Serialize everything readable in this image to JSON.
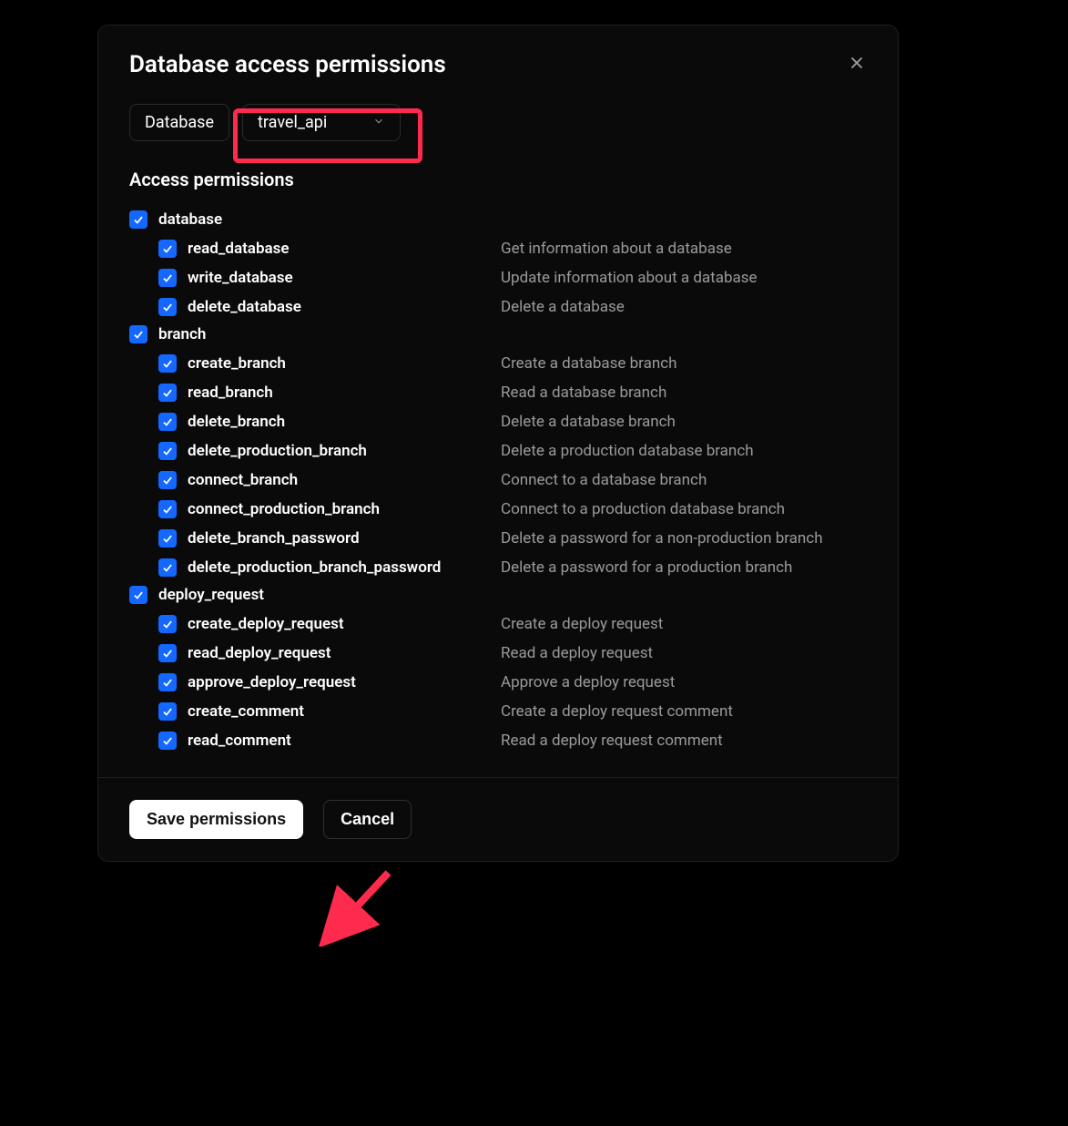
{
  "modal": {
    "title": "Database access permissions",
    "database_label": "Database",
    "database_selected": "travel_api",
    "section_title": "Access permissions",
    "save_label": "Save permissions",
    "cancel_label": "Cancel"
  },
  "groups": [
    {
      "name": "database",
      "checked": true,
      "perms": [
        {
          "name": "read_database",
          "desc": "Get information about a database",
          "checked": true
        },
        {
          "name": "write_database",
          "desc": "Update information about a database",
          "checked": true
        },
        {
          "name": "delete_database",
          "desc": "Delete a database",
          "checked": true
        }
      ]
    },
    {
      "name": "branch",
      "checked": true,
      "perms": [
        {
          "name": "create_branch",
          "desc": "Create a database branch",
          "checked": true
        },
        {
          "name": "read_branch",
          "desc": "Read a database branch",
          "checked": true
        },
        {
          "name": "delete_branch",
          "desc": "Delete a database branch",
          "checked": true
        },
        {
          "name": "delete_production_branch",
          "desc": "Delete a production database branch",
          "checked": true
        },
        {
          "name": "connect_branch",
          "desc": "Connect to a database branch",
          "checked": true
        },
        {
          "name": "connect_production_branch",
          "desc": "Connect to a production database branch",
          "checked": true
        },
        {
          "name": "delete_branch_password",
          "desc": "Delete a password for a non-production branch",
          "checked": true
        },
        {
          "name": "delete_production_branch_password",
          "desc": "Delete a password for a production branch",
          "checked": true
        }
      ]
    },
    {
      "name": "deploy_request",
      "checked": true,
      "perms": [
        {
          "name": "create_deploy_request",
          "desc": "Create a deploy request",
          "checked": true
        },
        {
          "name": "read_deploy_request",
          "desc": "Read a deploy request",
          "checked": true
        },
        {
          "name": "approve_deploy_request",
          "desc": "Approve a deploy request",
          "checked": true
        },
        {
          "name": "create_comment",
          "desc": "Create a deploy request comment",
          "checked": true
        },
        {
          "name": "read_comment",
          "desc": "Read a deploy request comment",
          "checked": true
        }
      ]
    }
  ],
  "annotations": {
    "highlight_on_select": true,
    "arrow_to_save": true
  }
}
